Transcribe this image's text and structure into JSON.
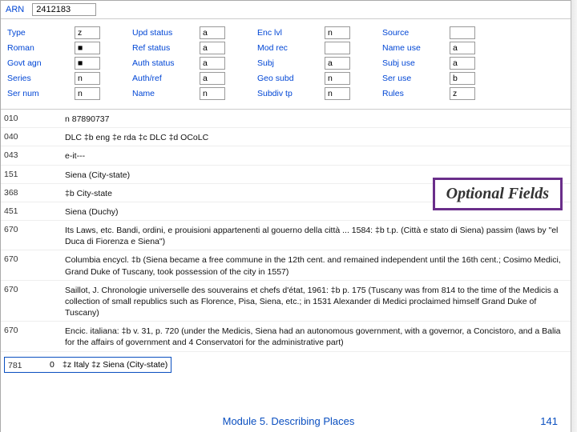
{
  "arn": {
    "label": "ARN",
    "value": "2412183"
  },
  "fixed": {
    "rows": [
      [
        {
          "l": "Type",
          "v": "z"
        },
        {
          "l": "Upd status",
          "v": "a"
        },
        {
          "l": "Enc lvl",
          "v": "n"
        },
        {
          "l": "Source",
          "v": ""
        }
      ],
      [
        {
          "l": "Roman",
          "v": "■"
        },
        {
          "l": "Ref status",
          "v": "a"
        },
        {
          "l": "Mod rec",
          "v": ""
        },
        {
          "l": "Name use",
          "v": "a"
        }
      ],
      [
        {
          "l": "Govt agn",
          "v": "■"
        },
        {
          "l": "Auth status",
          "v": "a"
        },
        {
          "l": "Subj",
          "v": "a"
        },
        {
          "l": "Subj use",
          "v": "a"
        }
      ],
      [
        {
          "l": "Series",
          "v": "n"
        },
        {
          "l": "Auth/ref",
          "v": "a"
        },
        {
          "l": "Geo subd",
          "v": "n"
        },
        {
          "l": "Ser use",
          "v": "b"
        }
      ],
      [
        {
          "l": "Ser num",
          "v": "n"
        },
        {
          "l": "Name",
          "v": "n"
        },
        {
          "l": "Subdiv tp",
          "v": "n"
        },
        {
          "l": "Rules",
          "v": "z"
        }
      ]
    ]
  },
  "tags": [
    {
      "tag": "010",
      "ind": "",
      "val": "n  87890737"
    },
    {
      "tag": "040",
      "ind": "",
      "val": "DLC ‡b eng ‡e rda ‡c DLC ‡d OCoLC"
    },
    {
      "tag": "043",
      "ind": "",
      "val": "e-it---"
    },
    {
      "tag": "151",
      "ind": "",
      "val": "Siena (City-state)"
    },
    {
      "tag": "368",
      "ind": "",
      "val": "‡b City-state"
    },
    {
      "tag": "451",
      "ind": "",
      "val": "Siena (Duchy)"
    },
    {
      "tag": "670",
      "ind": "",
      "val": "Its Laws, etc. Bandi, ordini, e prouisioni appartenenti al gouerno della città ... 1584: ‡b t.p. (Città e stato di Siena) passim (laws by \"el Duca di Fiorenza e Siena\")"
    },
    {
      "tag": "670",
      "ind": "",
      "val": "Columbia encycl. ‡b (Siena became a free commune in the 12th cent. and remained independent until the 16th cent.; Cosimo Medici, Grand Duke of Tuscany, took possession of the city in 1557)"
    },
    {
      "tag": "670",
      "ind": "",
      "val": "Saillot, J. Chronologie universelle des souverains et chefs d'état, 1961: ‡b p. 175 (Tuscany was from 814 to the time of the Medicis a collection of small republics such as Florence, Pisa, Siena, etc.; in 1531 Alexander di Medici proclaimed himself Grand Duke of Tuscany)"
    },
    {
      "tag": "670",
      "ind": "",
      "val": "Encic. italiana: ‡b v. 31, p. 720 (under the Medicis, Siena had an autonomous government, with a governor, a Concistoro, and a Balia for the affairs of government and 4 Conservatori for the administrative part)"
    }
  ],
  "row781": {
    "tag": "781",
    "ind1": "",
    "ind2": "0",
    "val": "‡z Italy ‡z Siena (City-state)"
  },
  "callout": "Optional Fields",
  "footer": {
    "module": "Module 5. Describing Places",
    "page": "141"
  }
}
